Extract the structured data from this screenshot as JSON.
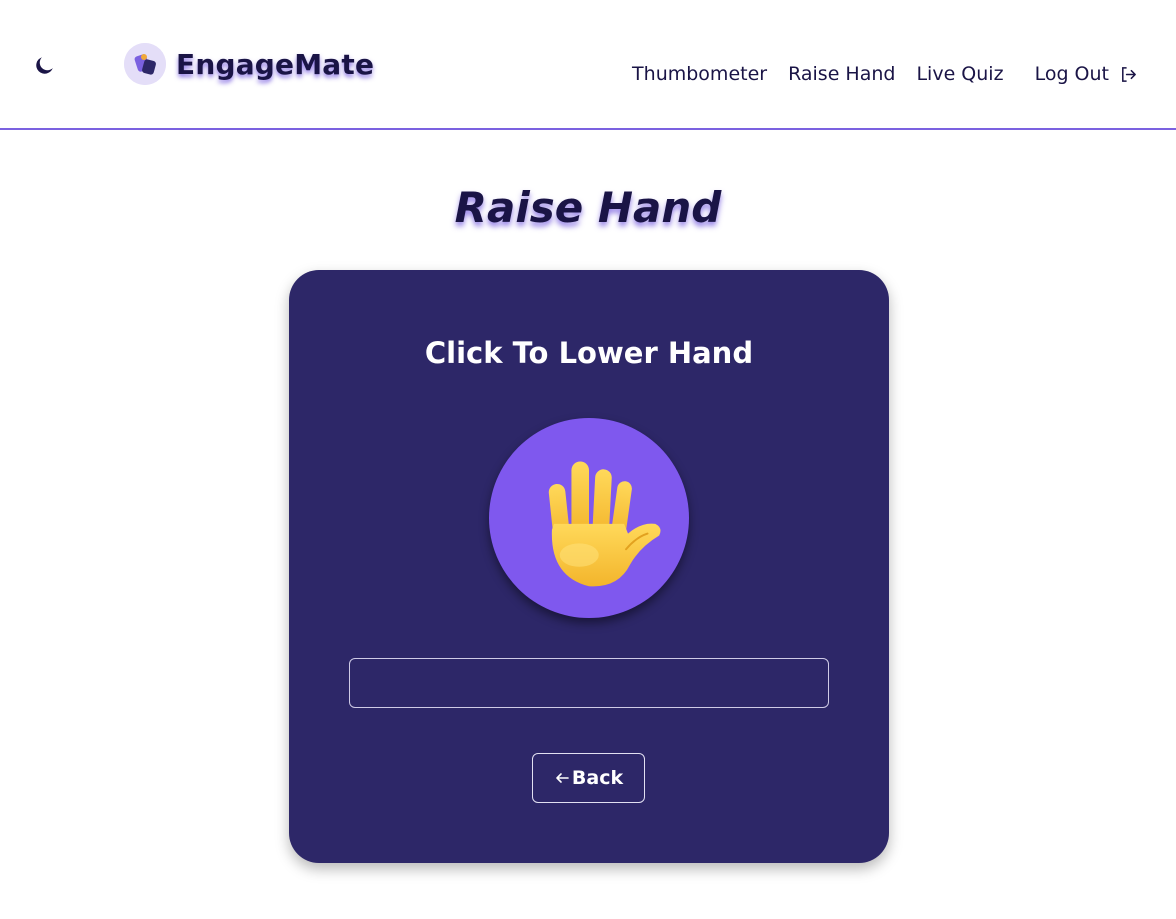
{
  "app": {
    "name": "EngageMate",
    "logo_icon": "engagemate-logo-icon",
    "theme_toggle_icon": "moon-icon"
  },
  "nav": {
    "items": [
      {
        "label": "Thumbometer"
      },
      {
        "label": "Raise Hand"
      },
      {
        "label": "Live Quiz"
      }
    ],
    "logout_label": "Log Out",
    "logout_icon": "logout-icon"
  },
  "page": {
    "title": "Raise Hand"
  },
  "card": {
    "heading": "Click To Lower Hand",
    "hand_icon": "raised-hand-icon",
    "message_value": "",
    "back_label": "Back",
    "back_icon": "arrow-left-icon"
  },
  "colors": {
    "accent": "#7b61e0",
    "card_background": "#2d2768",
    "hand_circle": "#7f58ee",
    "text_dark": "#1a1446"
  }
}
